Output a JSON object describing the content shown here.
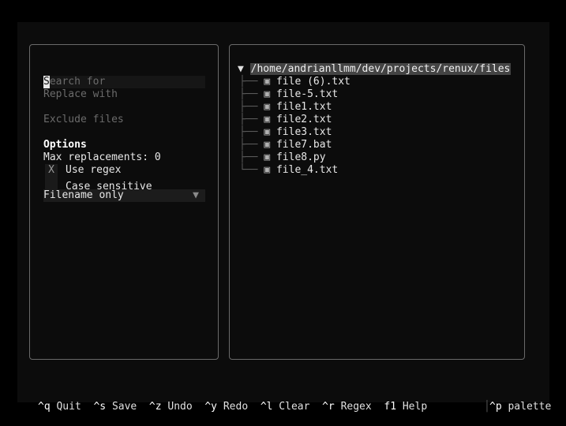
{
  "form": {
    "search_placeholder_first": "S",
    "search_placeholder_rest": "earch for",
    "replace_placeholder": "Replace with",
    "exclude_placeholder": "Exclude files",
    "options_heading": "Options",
    "max_replacements": "Max replacements: 0",
    "use_regex": {
      "mark": "X",
      "label": "Use regex",
      "checked": true
    },
    "case_sensitive": {
      "mark": "",
      "label": "Case sensitive",
      "checked": false
    },
    "mode_select": {
      "value": "Filename only",
      "arrow": "▼"
    }
  },
  "tree": {
    "expander": "▼",
    "root_path": "/home/andrianllmm/dev/projects/renux/files",
    "branch_glyph": "├──",
    "last_branch_glyph": "└──",
    "file_icon": "▣",
    "files": [
      "file (6).txt",
      "file-5.txt",
      "file1.txt",
      "file2.txt",
      "file3.txt",
      "file7.bat",
      "file8.py",
      "file_4.txt"
    ]
  },
  "statusbar": {
    "bindings": [
      {
        "key": "^q",
        "label": "Quit"
      },
      {
        "key": "^s",
        "label": "Save"
      },
      {
        "key": "^z",
        "label": "Undo"
      },
      {
        "key": "^y",
        "label": "Redo"
      },
      {
        "key": "^l",
        "label": "Clear"
      },
      {
        "key": "^r",
        "label": "Regex"
      },
      {
        "key": "f1",
        "label": "Help"
      }
    ],
    "separator": "│",
    "palette_key": "^p",
    "palette_label": "palette"
  },
  "colors": {
    "background": "#0c0c0c",
    "border": "#6a6a6a",
    "selected_path_bg": "#444444",
    "placeholder": "#6b6b6b"
  }
}
